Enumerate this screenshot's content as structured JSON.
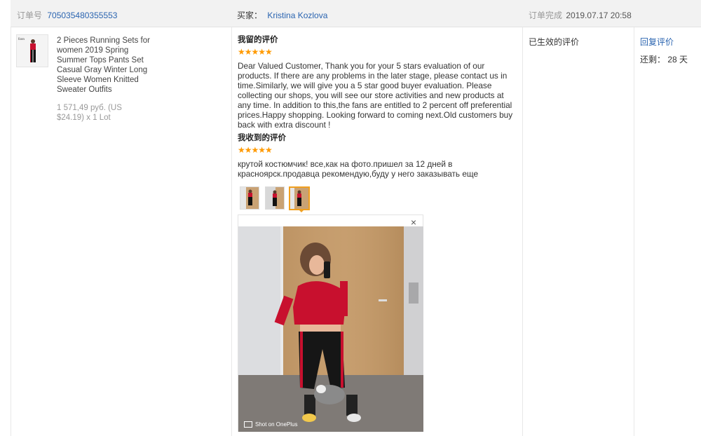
{
  "header": {
    "order_label": "订单号",
    "order_number": "705035480355553",
    "buyer_label": "买家：",
    "buyer_name": "Kristina Kozlova",
    "completed_label": "订单完成",
    "completed_time": "2019.07.17 20:58"
  },
  "product": {
    "title": "2 Pieces Running Sets for women 2019 Spring Summer Tops Pants Set Casual Gray Winter Long Sleeve Women Knitted Sweater Outfits",
    "price": "1 571,49 руб. (US $24.19) x 1 Lot",
    "thumb_label": "fzon"
  },
  "my_review": {
    "title": "我留的评价",
    "stars": "★★★★★",
    "text": "Dear Valued Customer, Thank you for your 5 stars evaluation of our products. If there are any problems in the later stage, please contact us in time.Similarly, we will give you a 5 star good buyer evaluation. Please collecting our shops, you will see our store activities and new products at any time. In addition to this,the fans are entitled to 2 percent off preferential prices.Happy shopping. Looking forward to coming next.Old customers buy back with extra discount !"
  },
  "received_review": {
    "title": "我收到的评价",
    "stars": "★★★★★",
    "text": "крутой костюмчик! все,как на фото.пришел за 12 дней в красноярск.продавца рекомендую,буду у него заказывать еще"
  },
  "viewer": {
    "close": "×",
    "watermark": "Shot on OnePlus"
  },
  "status": {
    "text": "已生效的评价"
  },
  "actions": {
    "reply": "回复评价",
    "remaining": "还剩： 28 天"
  },
  "colors": {
    "link": "#2a64b0",
    "star": "#ff9a00",
    "header_bg": "#f2f2f2"
  }
}
